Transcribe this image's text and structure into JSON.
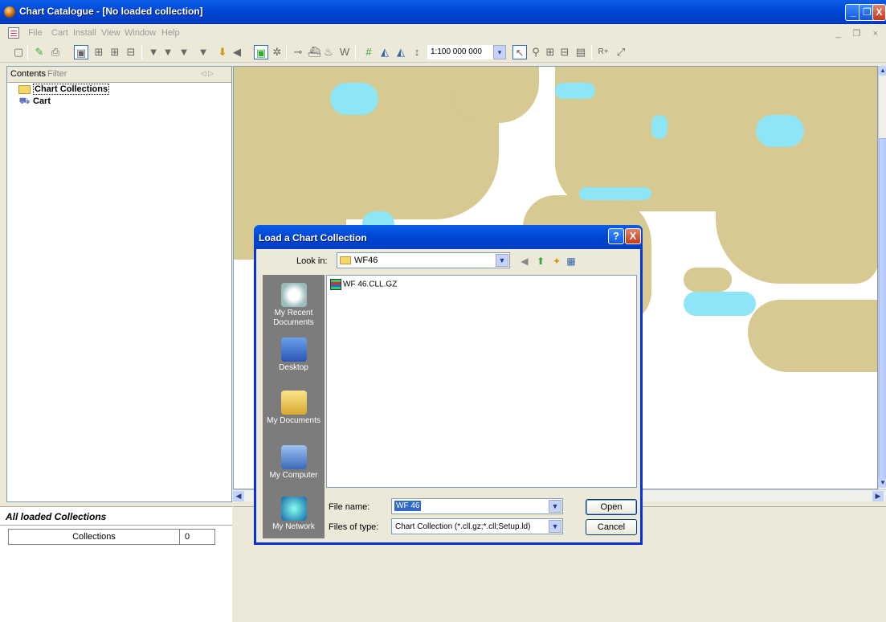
{
  "window": {
    "title": "Chart Catalogue - [No loaded collection]",
    "minimize": "_",
    "restore": "❐",
    "close": "X"
  },
  "menubar": {
    "items": [
      "File",
      "Cart",
      "Install",
      "View",
      "Window",
      "Help"
    ],
    "mdi_controls": "_ ❐ ×"
  },
  "toolbar": {
    "scale_value": "1:100 000 000",
    "dropdown_arrow": "▾"
  },
  "left_panel": {
    "tabs": [
      "Contents",
      "Filter"
    ],
    "tab_arrows": "◁ ▷",
    "tree": [
      "Chart Collections",
      "Cart"
    ]
  },
  "collections_panel": {
    "heading": "All loaded Collections",
    "row_label": "Collections",
    "row_value": "0"
  },
  "dialog": {
    "title": "Load a Chart Collection",
    "help_label": "?",
    "close_label": "X",
    "look_in_label": "Look in:",
    "look_in_value": "WF46",
    "places": [
      "My Recent Documents",
      "Desktop",
      "My Documents",
      "My Computer",
      "My Network"
    ],
    "files": [
      "WF 46.CLL.GZ"
    ],
    "file_name_label": "File name:",
    "file_name_value": "WF 46",
    "files_of_type_label": "Files of type:",
    "files_of_type_value": "Chart Collection (*.cll.gz;*.cll;Setup.ld)",
    "open_button": "Open",
    "cancel_button": "Cancel"
  },
  "colors": {
    "xp_blue": "#0046d5",
    "land": "#d6c991",
    "shallow_water": "#8ee5f5",
    "places_bar": "#7c7c7c"
  }
}
